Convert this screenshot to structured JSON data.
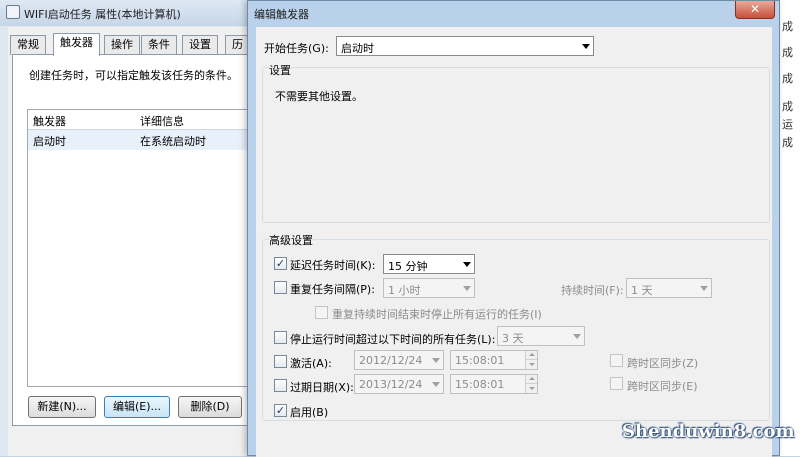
{
  "props_window": {
    "title": "WIFI启动任务 属性(本地计算机)",
    "tabs": [
      "常规",
      "触发器",
      "操作",
      "条件",
      "设置",
      "历"
    ],
    "active_tab": "触发器",
    "description": "创建任务时，可以指定触发该任务的条件。",
    "table": {
      "columns": [
        "触发器",
        "详细信息"
      ],
      "rows": [
        [
          "启动时",
          "在系统启动时"
        ]
      ]
    },
    "buttons": {
      "new": "新建(N)...",
      "edit": "编辑(E)...",
      "delete": "删除(D)"
    }
  },
  "right_strip": [
    "成",
    "成",
    "成",
    "成",
    "运",
    "成"
  ],
  "dialog": {
    "title": "编辑触发器",
    "close_glyph": "✕",
    "begin_task_label": "开始任务(G):",
    "begin_task_value": "启动时",
    "settings_group_title": "设置",
    "settings_note": "不需要其他设置。",
    "advanced_group_title": "高级设置",
    "delay": {
      "label": "延迟任务时间(K):",
      "checked": true,
      "value": "15 分钟"
    },
    "repeat": {
      "label": "重复任务间隔(P):",
      "checked": false,
      "value": "1 小时",
      "duration_label": "持续时间(F):",
      "duration_value": "1 天"
    },
    "stop_running": {
      "label": "重复持续时间结束时停止所有运行的任务(I)",
      "checked": false
    },
    "stop_longer": {
      "label": "停止运行时间超过以下时间的所有任务(L):",
      "checked": false,
      "value": "3 天"
    },
    "activate": {
      "label": "激活(A):",
      "checked": false,
      "date": "2012/12/24",
      "time": "15:08:01",
      "sync_label": "跨时区同步(Z)"
    },
    "expire": {
      "label": "过期日期(X):",
      "checked": false,
      "date": "2013/12/24",
      "time": "15:08:01",
      "sync_label": "跨时区同步(E)"
    },
    "enabled": {
      "label": "启用(B)",
      "checked": true
    },
    "check_glyph": "✓"
  },
  "watermark": "Shenduwin8.com"
}
